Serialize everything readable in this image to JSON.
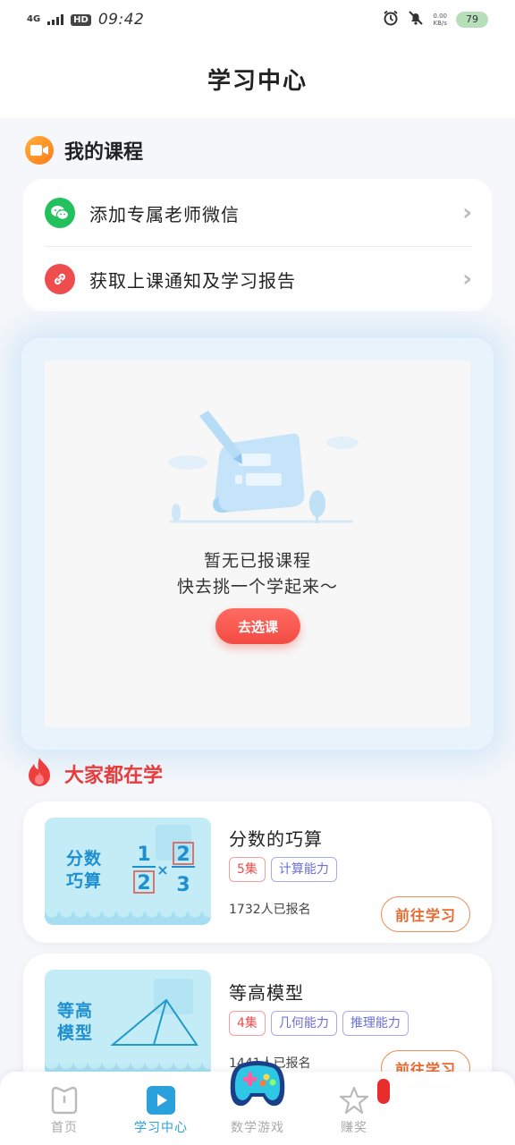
{
  "status_bar": {
    "network": "4G",
    "hd": "HD",
    "time": "09:42",
    "speed_value": "0.00",
    "speed_unit": "KB/s",
    "battery": "79"
  },
  "header": {
    "title": "学习中心"
  },
  "my_courses": {
    "section_title": "我的课程",
    "rows": [
      {
        "label": "添加专属老师微信",
        "icon": "wechat-icon"
      },
      {
        "label": "获取上课通知及学习报告",
        "icon": "link-icon"
      }
    ]
  },
  "empty_state": {
    "line1": "暂无已报课程",
    "line2": "快去挑一个学起来～",
    "button_label": "去选课"
  },
  "popular": {
    "section_title": "大家都在学",
    "courses": [
      {
        "title": "分数的巧算",
        "thumb_text": [
          "分数",
          "巧算"
        ],
        "tags": [
          "5集",
          "计算能力"
        ],
        "enrolled": "1732人已报名",
        "button_label": "前往学习"
      },
      {
        "title": "等高模型",
        "thumb_text": [
          "等高",
          "模型"
        ],
        "tags": [
          "4集",
          "几何能力",
          "推理能力"
        ],
        "enrolled": "1441人已报名",
        "button_label": "前往学习"
      }
    ]
  },
  "bottom_nav": {
    "items": [
      {
        "label": "首页",
        "active": false
      },
      {
        "label": "学习中心",
        "active": true
      },
      {
        "label": "数学游戏",
        "active": false
      },
      {
        "label": "赚奖",
        "active": false
      }
    ]
  },
  "colors": {
    "accent_blue": "#2aa0dc",
    "accent_red": "#e83b3b",
    "button_red": "#f24b43",
    "study_orange": "#e8692f"
  }
}
